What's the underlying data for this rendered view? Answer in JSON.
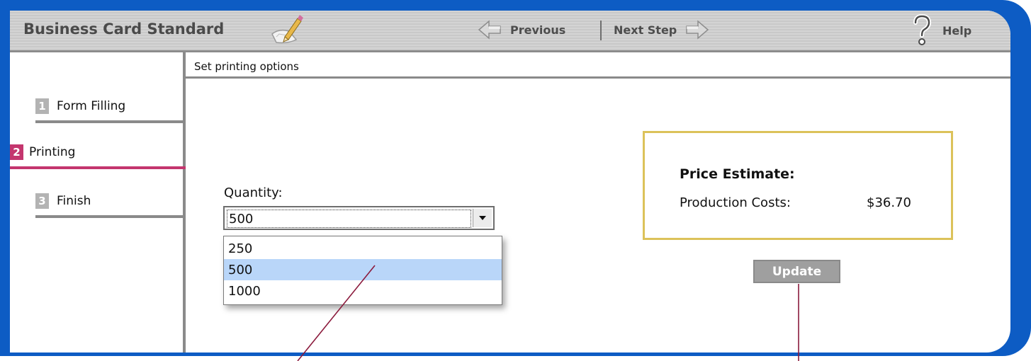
{
  "app": {
    "title": "Business Card Standard"
  },
  "toolbar": {
    "previous_label": "Previous",
    "next_label": "Next Step",
    "help_label": "Help"
  },
  "sidebar": {
    "steps": [
      {
        "number": "1",
        "label": "Form Filling",
        "active": false
      },
      {
        "number": "2",
        "label": "Printing",
        "active": true
      },
      {
        "number": "3",
        "label": "Finish",
        "active": false
      }
    ]
  },
  "content": {
    "header": "Set printing options",
    "quantity": {
      "label": "Quantity:",
      "selected": "500",
      "options": [
        "250",
        "500",
        "1000"
      ]
    },
    "price": {
      "title": "Price Estimate:",
      "cost_label": "Production Costs:",
      "cost_value": "$36.70"
    },
    "update_label": "Update"
  },
  "colors": {
    "frame": "#0d5cc4",
    "active_step": "#c4366e",
    "price_border": "#dcc25a",
    "selected_option": "#b9d6f9",
    "annotation_line": "#8b1a3c"
  }
}
